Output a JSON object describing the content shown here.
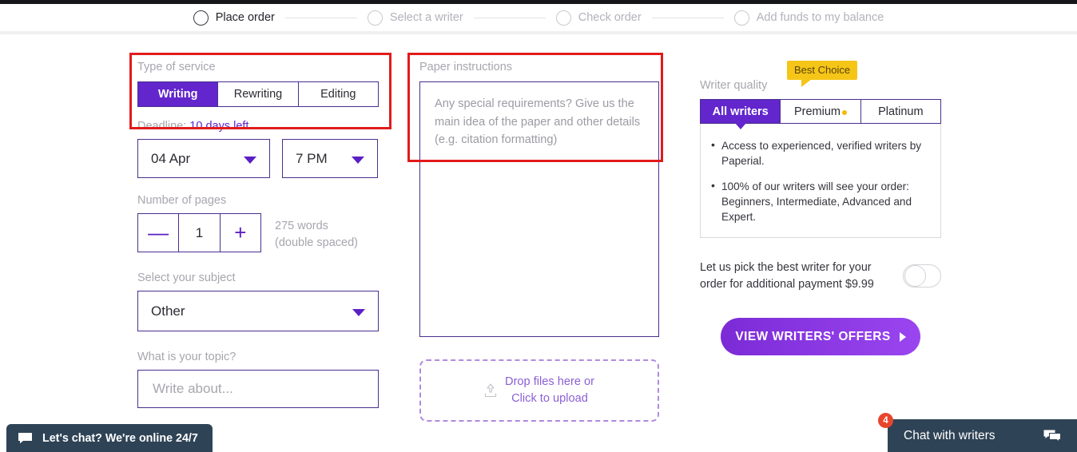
{
  "steps": [
    {
      "label": "Place order",
      "active": true
    },
    {
      "label": "Select a writer",
      "active": false
    },
    {
      "label": "Check order",
      "active": false
    },
    {
      "label": "Add funds to my balance",
      "active": false
    }
  ],
  "service": {
    "label": "Type of service",
    "options": [
      "Writing",
      "Rewriting",
      "Editing"
    ],
    "selected": "Writing"
  },
  "deadline": {
    "label": "Deadline:",
    "value": "10 days left",
    "date": "04 Apr",
    "time": "7 PM"
  },
  "pages": {
    "label": "Number of pages",
    "count": "1",
    "minus": "—",
    "plus": "+",
    "words_line1": "275 words",
    "words_line2": "(double spaced)"
  },
  "subject": {
    "label": "Select your subject",
    "selected": "Other"
  },
  "topic": {
    "label": "What is your topic?",
    "placeholder": "Write about...",
    "value": ""
  },
  "instructions": {
    "label": "Paper instructions",
    "placeholder": "Any special requirements? Give us the main idea of the paper and other details (e.g. citation formatting)",
    "value": ""
  },
  "upload": {
    "line1": "Drop files here or",
    "line2": "Click to upload",
    "icon": "upload-icon"
  },
  "writer_quality": {
    "label": "Writer quality",
    "best_choice_badge": "Best Choice",
    "tabs": [
      "All writers",
      "Premium",
      "Platinum"
    ],
    "selected": "All writers",
    "premium_dot_color": "#f5b90b",
    "benefits": [
      "Access to experienced, verified writers by Paperial.",
      "100% of our writers will see your order: Beginners, Intermediate, Advanced and Expert."
    ]
  },
  "best_writer": {
    "text": "Let us pick the best writer for your order for additional payment $9.99",
    "toggle_on": false
  },
  "cta": {
    "label": "VIEW WRITERS' OFFERS",
    "icon": "chevron-right-icon"
  },
  "chat_left": {
    "text": "Let's chat? We're online 24/7",
    "icon": "chat-bubble-icon"
  },
  "chat_right": {
    "text": "Chat with writers",
    "badge": "4",
    "icon": "chat-windows-icon"
  },
  "colors": {
    "accent_purple": "#6226cc",
    "border_purple": "#4a2f8f",
    "highlight_red": "#e11b1b",
    "badge_yellow": "#f5c518",
    "chat_navy": "#2f4356",
    "badge_red": "#e8452c"
  }
}
